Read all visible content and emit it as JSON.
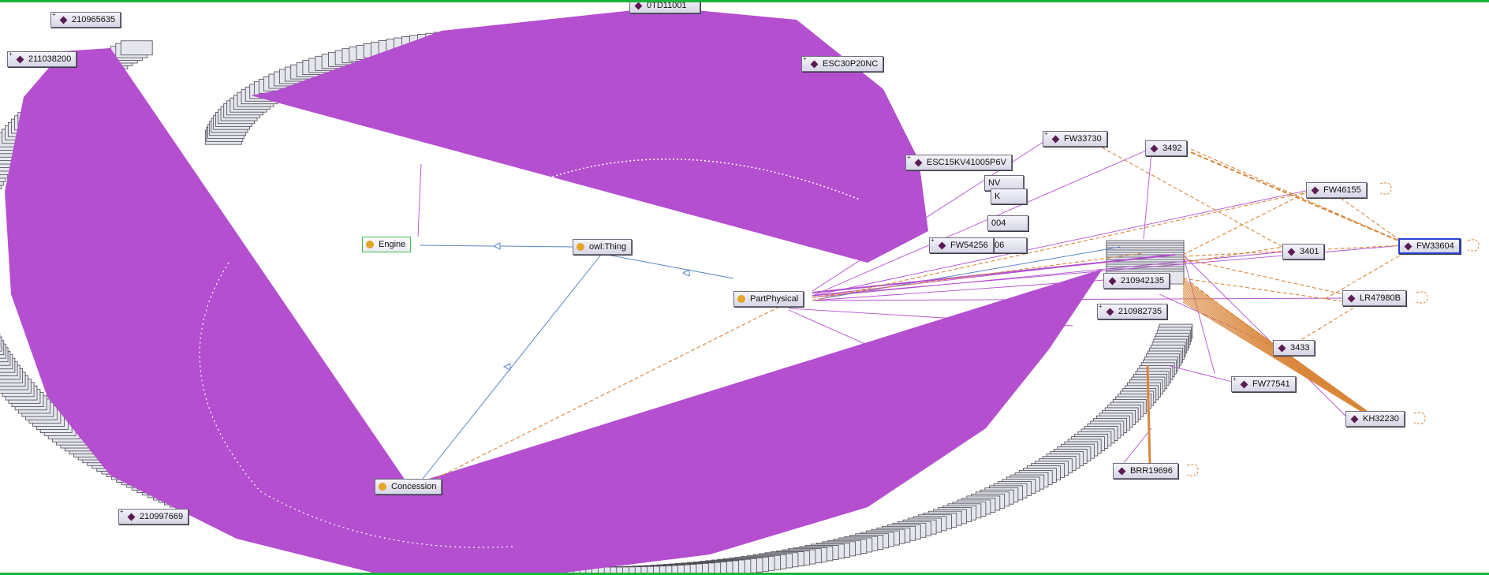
{
  "colors": {
    "subclass": "#5b86c4",
    "individual": "#b44fd0",
    "object_property": "#d9863a",
    "class_dot": "#e3a62a",
    "individual_diamond": "#5b1a52",
    "selected_border": "#2a3fd6",
    "frame": "#19b23a"
  },
  "classes": {
    "owl_thing": "owl:Thing",
    "engine": "Engine",
    "part_physical": "PartPhysical",
    "concession": "Concession"
  },
  "individuals": {
    "i_210965635": "210965635",
    "i_211038200": "211038200",
    "i_210997669": "210997669",
    "esc30p20nc": "ESC30P20NC",
    "esc15kv": "ESC15KV41005P6V",
    "fw54256": "FW54256",
    "fw33730": "FW33730",
    "n3492": "3492",
    "fw46155": "FW46155",
    "n3401": "3401",
    "fw33604": "FW33604",
    "i_210942135": "210942135",
    "i_210982735": "210982735",
    "lr47980b": "LR47980B",
    "n3433": "3433",
    "fw77541": "FW77541",
    "kh32230": "KH32230",
    "brr19696": "BRR19696"
  },
  "partial_labels": {
    "top_cut": "0TD11001",
    "nv": "NV",
    "k": "K",
    "n004": "004",
    "n06": "06"
  }
}
